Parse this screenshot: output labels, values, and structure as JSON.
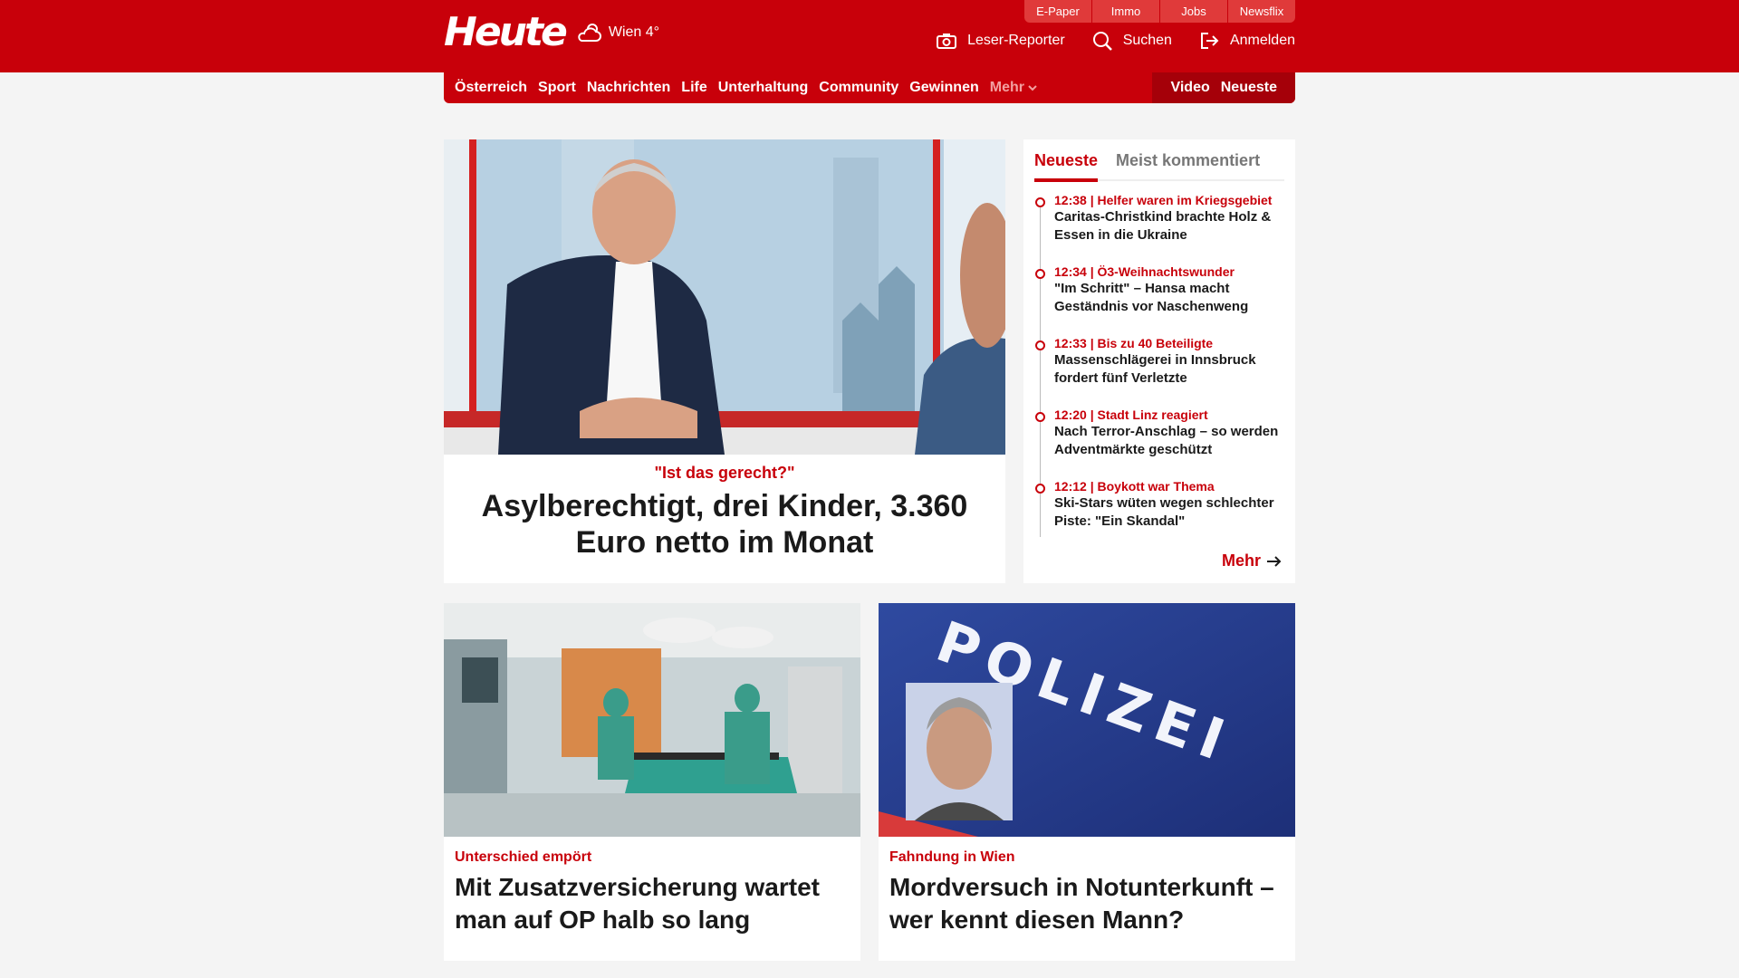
{
  "brand": {
    "logo": "Heute",
    "weather": "Wien 4°"
  },
  "service_links": [
    "E-Paper",
    "Immo",
    "Jobs",
    "Newsflix"
  ],
  "actions": {
    "reporter": "Leser-Reporter",
    "search": "Suchen",
    "login": "Anmelden"
  },
  "nav": {
    "items": [
      "Österreich",
      "Sport",
      "Nachrichten",
      "Life",
      "Unterhaltung",
      "Community",
      "Gewinnen"
    ],
    "more": "Mehr",
    "video": "Video",
    "latest": "Neueste"
  },
  "hero": {
    "kicker": "\"Ist das gerecht?\"",
    "title": "Asylberechtigt, drei Kinder, 3.360 Euro netto im Monat"
  },
  "sidebar": {
    "tabs": [
      "Neueste",
      "Meist kommentiert"
    ],
    "items": [
      {
        "meta": "12:38 | Helfer waren im Kriegsgebiet",
        "title": "Caritas-Christkind brachte Holz & Essen in die Ukraine"
      },
      {
        "meta": "12:34 | Ö3-Weihnachtswunder",
        "title": "\"Im Schritt\" – Hansa macht Geständnis vor Naschenweng"
      },
      {
        "meta": "12:33 | Bis zu 40 Beteiligte",
        "title": "Massenschlägerei in Innsbruck fordert fünf Verletzte"
      },
      {
        "meta": "12:20 | Stadt Linz reagiert",
        "title": "Nach Terror-Anschlag – so werden Adventmärkte geschützt"
      },
      {
        "meta": "12:12 | Boykott war Thema",
        "title": "Ski-Stars wüten wegen schlechter Piste: \"Ein Skandal\""
      }
    ],
    "more": "Mehr"
  },
  "cards": [
    {
      "kicker": "Unterschied empört",
      "title": "Mit Zusatzversicherung wartet man auf OP halb so lang"
    },
    {
      "kicker": "Fahndung in Wien",
      "title": "Mordversuch in Notunterkunft – wer kennt diesen Mann?",
      "image_text": "POLIZEI"
    }
  ],
  "colors": {
    "brand_red": "#c8000a",
    "background": "#f4f4f4"
  }
}
